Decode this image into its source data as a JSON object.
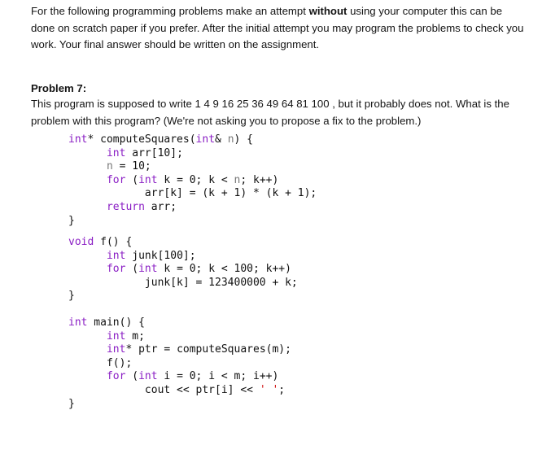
{
  "intro": {
    "text_before": "For the following programming problems make an attempt ",
    "bold": "without",
    "text_after": " using your computer this can be done on scratch paper if you prefer.  After the initial attempt you may program the problems to check you work. Your final answer should be written on the assignment."
  },
  "problem": {
    "title": "Problem 7:",
    "description": "This program is supposed to write 1 4 9 16 25 36 49 64 81 100 , but it probably does not. What is the problem with this program? (We're not asking you to propose a fix to the problem.)"
  },
  "code": {
    "computeSquares": [
      "int* computeSquares(int& n) {",
      "      int arr[10];",
      "      n = 10;",
      "      for (int k = 0; k < n; k++)",
      "            arr[k] = (k + 1) * (k + 1);",
      "      return arr;",
      "}"
    ],
    "f": [
      "void f() {",
      "      int junk[100];",
      "      for (int k = 0; k < 100; k++)",
      "            junk[k] = 123400000 + k;",
      "}"
    ],
    "main": [
      "int main() {",
      "      int m;",
      "      int* ptr = computeSquares(m);",
      "      f();",
      "      for (int i = 0; i < m; i++)",
      "            cout << ptr[i] << ' ';",
      "}"
    ]
  },
  "colors": {
    "keyword": "#8a1ec4",
    "param": "#777777",
    "char_literal": "#d01010"
  }
}
